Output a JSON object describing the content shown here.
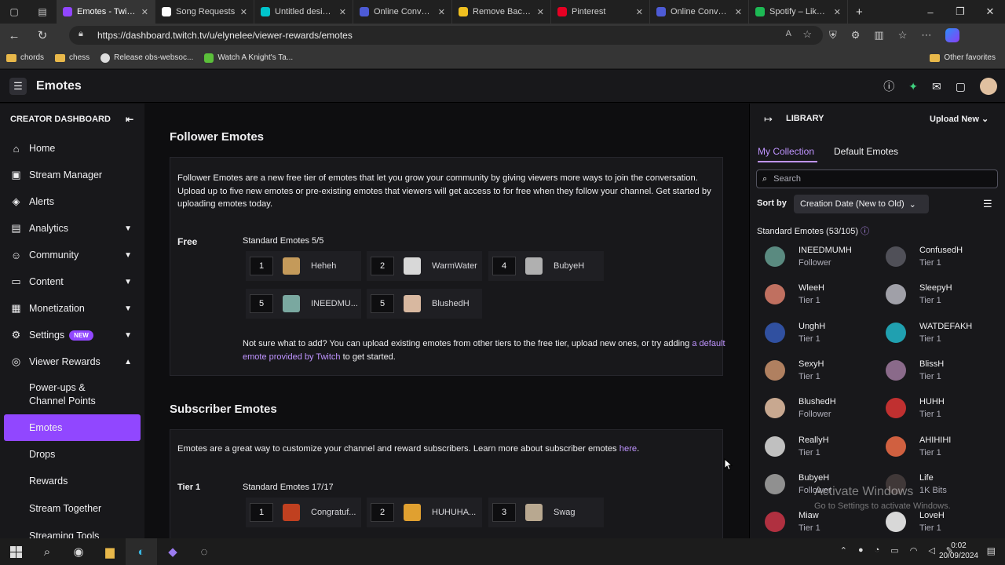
{
  "browser": {
    "tabs": [
      {
        "label": "Emotes - Twitch",
        "color": "#9146ff"
      },
      {
        "label": "Song Requests",
        "color": "#ffffff"
      },
      {
        "label": "Untitled design -",
        "color": "#00c4cc"
      },
      {
        "label": "Online Converter",
        "color": "#4d5bd6"
      },
      {
        "label": "Remove Backgrou",
        "color": "#f0c020"
      },
      {
        "label": "Pinterest",
        "color": "#e60023"
      },
      {
        "label": "Online Converter",
        "color": "#4d5bd6"
      },
      {
        "label": "Spotify – Liked So",
        "color": "#1db954"
      }
    ],
    "url": "https://dashboard.twitch.tv/u/elynelee/viewer-rewards/emotes",
    "bookmarks": [
      "chords",
      "chess",
      "Release obs-websoc...",
      "Watch A Knight's Ta..."
    ],
    "other_favorites": "Other favorites"
  },
  "header": {
    "title": "Emotes"
  },
  "sidebar": {
    "title": "CREATOR DASHBOARD",
    "items": [
      {
        "label": "Home",
        "icon": "home-icon"
      },
      {
        "label": "Stream Manager",
        "icon": "stream-manager-icon"
      },
      {
        "label": "Alerts",
        "icon": "alerts-icon"
      },
      {
        "label": "Analytics",
        "icon": "analytics-icon"
      },
      {
        "label": "Community",
        "icon": "community-icon"
      },
      {
        "label": "Content",
        "icon": "content-icon"
      },
      {
        "label": "Monetization",
        "icon": "monetization-icon"
      },
      {
        "label": "Settings",
        "icon": "settings-icon",
        "badge": "NEW"
      },
      {
        "label": "Viewer Rewards",
        "icon": "viewer-rewards-icon"
      }
    ],
    "subitems": [
      "Power-ups &",
      "Channel Points",
      "Emotes",
      "Drops",
      "Rewards"
    ],
    "after": [
      "Stream Together",
      "Streaming Tools"
    ]
  },
  "follower": {
    "title": "Follower Emotes",
    "desc": "Follower Emotes are a new free tier of emotes that let you grow your community by giving viewers more ways to join the conversation. Upload up to five new emotes or pre-existing emotes that viewers will get access to for free when they follow your channel. Get started by uploading emotes today.",
    "free_label": "Free",
    "standard": "Standard Emotes 5/5",
    "slots": [
      {
        "num": "1",
        "name": "Heheh",
        "color": "#c49a5a"
      },
      {
        "num": "2",
        "name": "WarmWater",
        "color": "#d8d8d8"
      },
      {
        "num": "4",
        "name": "BubyeH",
        "color": "#b0b0b0"
      },
      {
        "num": "5",
        "name": "INEEDMU...",
        "color": "#7aa8a0"
      },
      {
        "num": "5",
        "name": "BlushedH",
        "color": "#d8b8a0"
      }
    ],
    "note_pre": "Not sure what to add? You can upload existing emotes from other tiers to the free tier, upload new ones, or try adding",
    "note_link1": "a",
    "note_link2": "default emote provided by Twitch",
    "note_post": "to get started."
  },
  "subscriber": {
    "title": "Subscriber Emotes",
    "desc": "Emotes are a great way to customize your channel and reward subscribers. Learn more about subscriber emotes",
    "desc_link": "here",
    "tier_label": "Tier 1",
    "standard": "Standard Emotes 17/17",
    "slots": [
      {
        "num": "1",
        "name": "Congratuf...",
        "color": "#c04020"
      },
      {
        "num": "2",
        "name": "HUHUHA...",
        "color": "#e0a030"
      },
      {
        "num": "3",
        "name": "Swag",
        "color": "#b8a890"
      }
    ]
  },
  "library": {
    "title": "LIBRARY",
    "upload": "Upload New",
    "tabs": [
      "My Collection",
      "Default Emotes"
    ],
    "search_placeholder": "Search",
    "sort_label": "Sort by",
    "sort_value": "Creation Date (New to Old)",
    "section": "Standard Emotes (53/105)",
    "items": [
      {
        "name": "INEEDMUMH",
        "tier": "Follower",
        "color": "#5a8a80"
      },
      {
        "name": "ConfusedH",
        "tier": "Tier 1",
        "color": "#505058"
      },
      {
        "name": "WleeH",
        "tier": "Tier 1",
        "color": "#c07060"
      },
      {
        "name": "SleepyH",
        "tier": "Tier 1",
        "color": "#a0a0a8"
      },
      {
        "name": "UnghH",
        "tier": "Tier 1",
        "color": "#3050a0"
      },
      {
        "name": "WATDEFAKH",
        "tier": "Tier 1",
        "color": "#20a0b0"
      },
      {
        "name": "SexyH",
        "tier": "Tier 1",
        "color": "#b08060"
      },
      {
        "name": "BlissH",
        "tier": "Tier 1",
        "color": "#8a6a8a"
      },
      {
        "name": "BlushedH",
        "tier": "Follower",
        "color": "#c8a890"
      },
      {
        "name": "HUHH",
        "tier": "Tier 1",
        "color": "#c03030"
      },
      {
        "name": "ReallyH",
        "tier": "Tier 1",
        "color": "#c0c0c0"
      },
      {
        "name": "AHIHIHI",
        "tier": "Tier 1",
        "color": "#d06040"
      },
      {
        "name": "BubyeH",
        "tier": "Follower",
        "color": "#909090"
      },
      {
        "name": "Life",
        "tier": "1K Bits",
        "color": "#403838"
      },
      {
        "name": "Miaw",
        "tier": "Tier 1",
        "color": "#b03040"
      },
      {
        "name": "LoveH",
        "tier": "Tier 1",
        "color": "#d8d8d8"
      }
    ]
  },
  "watermark": {
    "line1": "Activate Windows",
    "line2": "Go to Settings to activate Windows."
  },
  "taskbar": {
    "time": "0:02",
    "date": "20/09/2024"
  }
}
